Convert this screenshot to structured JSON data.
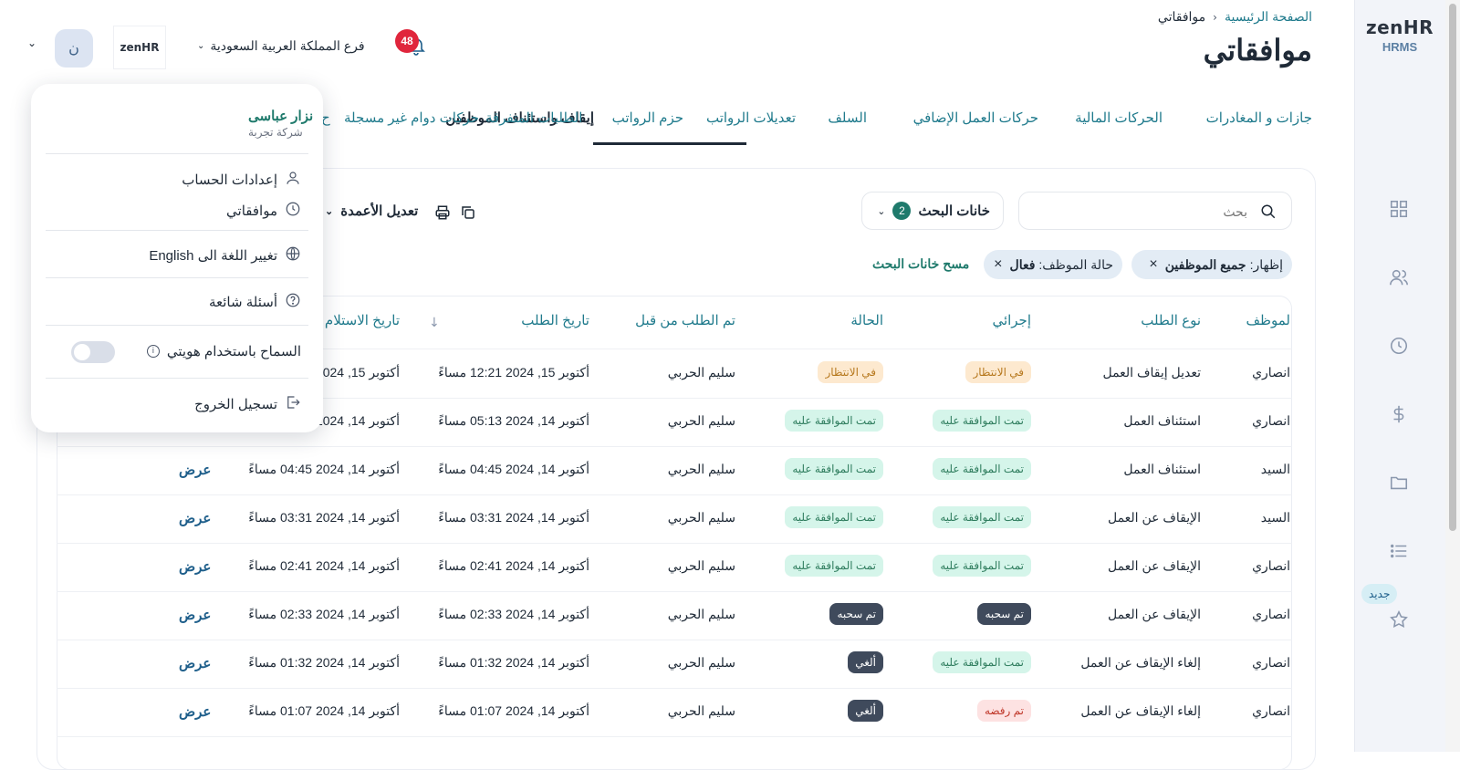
{
  "brand": {
    "logo_main": "zen",
    "logo_accent": "HR",
    "product": "HRMS",
    "small_logo_text": "zenHR"
  },
  "header": {
    "breadcrumb_home": "الصفحة الرئيسية",
    "breadcrumb_current": "موافقاتي",
    "page_title": "موافقاتي",
    "branch_selector": "فرع المملكة العربية السعودية",
    "notification_count": "48",
    "user_initial": "ن"
  },
  "tabs": [
    {
      "label": "جازات و المغادرات"
    },
    {
      "label": "الحركات المالية"
    },
    {
      "label": "حركات العمل الإضافي"
    },
    {
      "label": "السلف"
    },
    {
      "label": "تعديلات الرواتب"
    },
    {
      "label": "حزم الرواتب"
    },
    {
      "label": "إيقاف واستئناف الموظفين",
      "active": true
    },
    {
      "label": "الطلبات المتفرقة"
    },
    {
      "label": "حركات دوام غير مسجلة"
    },
    {
      "label": "ح"
    }
  ],
  "toolbar": {
    "search_placeholder": "بحث",
    "filter_button": "خانات البحث",
    "filter_count": "2",
    "edit_columns": "تعديل الأعمدة"
  },
  "filters": {
    "chip1_label": "إظهار:",
    "chip1_value": "جميع الموظفين",
    "chip2_label": "حالة الموظف:",
    "chip2_value": "فعال",
    "clear_link": "مسح خانات البحث"
  },
  "table": {
    "columns": [
      "لموظف",
      "نوع الطلب",
      "إجرائي",
      "الحالة",
      "تم الطلب من قبل",
      "تاريخ الطلب",
      "تاريخ الاستلام"
    ],
    "rows": [
      {
        "employee": "انصاري",
        "type": "تعديل إيقاف العمل",
        "action": "في الانتظار",
        "action_kind": "pending",
        "status": "في الانتظار",
        "status_kind": "pending",
        "requested_by": "سليم الحربي",
        "request_date": "أكتوبر 15, 2024 12:21 مساءً",
        "received_date": "أكتوبر 15, 2024",
        "view": ""
      },
      {
        "employee": "انصاري",
        "type": "استئناف العمل",
        "action": "تمت الموافقة عليه",
        "action_kind": "approved",
        "status": "تمت الموافقة عليه",
        "status_kind": "approved",
        "requested_by": "سليم الحربي",
        "request_date": "أكتوبر 14, 2024 05:13 مساءً",
        "received_date": "أكتوبر 14, 2024",
        "view": ""
      },
      {
        "employee": "السيد",
        "type": "استئناف العمل",
        "action": "تمت الموافقة عليه",
        "action_kind": "approved",
        "status": "تمت الموافقة عليه",
        "status_kind": "approved",
        "requested_by": "سليم الحربي",
        "request_date": "أكتوبر 14, 2024 04:45 مساءً",
        "received_date": "أكتوبر 14, 2024 04:45 مساءً",
        "view": "عرض"
      },
      {
        "employee": "السيد",
        "type": "الإيقاف عن العمل",
        "action": "تمت الموافقة عليه",
        "action_kind": "approved",
        "status": "تمت الموافقة عليه",
        "status_kind": "approved",
        "requested_by": "سليم الحربي",
        "request_date": "أكتوبر 14, 2024 03:31 مساءً",
        "received_date": "أكتوبر 14, 2024 03:31 مساءً",
        "view": "عرض"
      },
      {
        "employee": "انصاري",
        "type": "الإيقاف عن العمل",
        "action": "تمت الموافقة عليه",
        "action_kind": "approved",
        "status": "تمت الموافقة عليه",
        "status_kind": "approved",
        "requested_by": "سليم الحربي",
        "request_date": "أكتوبر 14, 2024 02:41 مساءً",
        "received_date": "أكتوبر 14, 2024 02:41 مساءً",
        "view": "عرض"
      },
      {
        "employee": "انصاري",
        "type": "الإيقاف عن العمل",
        "action": "تم سحبه",
        "action_kind": "withdrawn",
        "status": "تم سحبه",
        "status_kind": "withdrawn",
        "requested_by": "سليم الحربي",
        "request_date": "أكتوبر 14, 2024 02:33 مساءً",
        "received_date": "أكتوبر 14, 2024 02:33 مساءً",
        "view": "عرض"
      },
      {
        "employee": "انصاري",
        "type": "إلغاء الإيقاف عن العمل",
        "action": "تمت الموافقة عليه",
        "action_kind": "approved",
        "status": "ألغي",
        "status_kind": "cancelled",
        "requested_by": "سليم الحربي",
        "request_date": "أكتوبر 14, 2024 01:32 مساءً",
        "received_date": "أكتوبر 14, 2024 01:32 مساءً",
        "view": "عرض"
      },
      {
        "employee": "انصاري",
        "type": "إلغاء الإيقاف عن العمل",
        "action": "تم رفضه",
        "action_kind": "rejected",
        "status": "ألغي",
        "status_kind": "cancelled",
        "requested_by": "سليم الحربي",
        "request_date": "أكتوبر 14, 2024 01:07 مساءً",
        "received_date": "أكتوبر 14, 2024 01:07 مساءً",
        "view": "عرض"
      }
    ]
  },
  "user_menu": {
    "name": "نزار عباسى",
    "company": "شركة تجربة",
    "account_settings": "إعدادات الحساب",
    "my_approvals": "موافقاتي",
    "change_language": "تغيير اللغة الى English",
    "faq": "أسئلة شائعة",
    "allow_identity": "السماح باستخدام هويتي",
    "logout": "تسجيل الخروج"
  },
  "sidebar": {
    "new_badge": "جديد"
  },
  "colors": {
    "accent": "#1f7a8c",
    "sidebar_bg": "#f2f4f9",
    "notification": "#e0263c"
  }
}
